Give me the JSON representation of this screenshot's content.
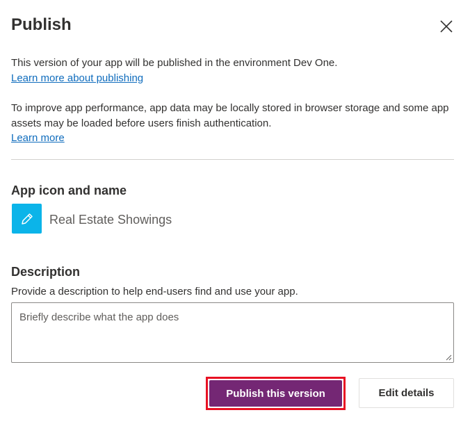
{
  "dialog": {
    "title": "Publish",
    "close_icon": "close-icon"
  },
  "intro": {
    "environment_text": "This version of your app will be published in the environment Dev One.",
    "publishing_link": "Learn more about publishing",
    "performance_text": "To improve app performance, app data may be locally stored in browser storage and some app assets may be loaded before users finish authentication.",
    "learn_more_link": "Learn more"
  },
  "app_section": {
    "heading": "App icon and name",
    "icon": "pencil-icon",
    "icon_color": "#0bb4e9",
    "app_name": "Real Estate Showings"
  },
  "description": {
    "heading": "Description",
    "help_text": "Provide a description to help end-users find and use your app.",
    "value": "",
    "placeholder": "Briefly describe what the app does"
  },
  "actions": {
    "publish_label": "Publish this version",
    "publish_color": "#742774",
    "highlight_color": "#e81123",
    "edit_label": "Edit details"
  }
}
